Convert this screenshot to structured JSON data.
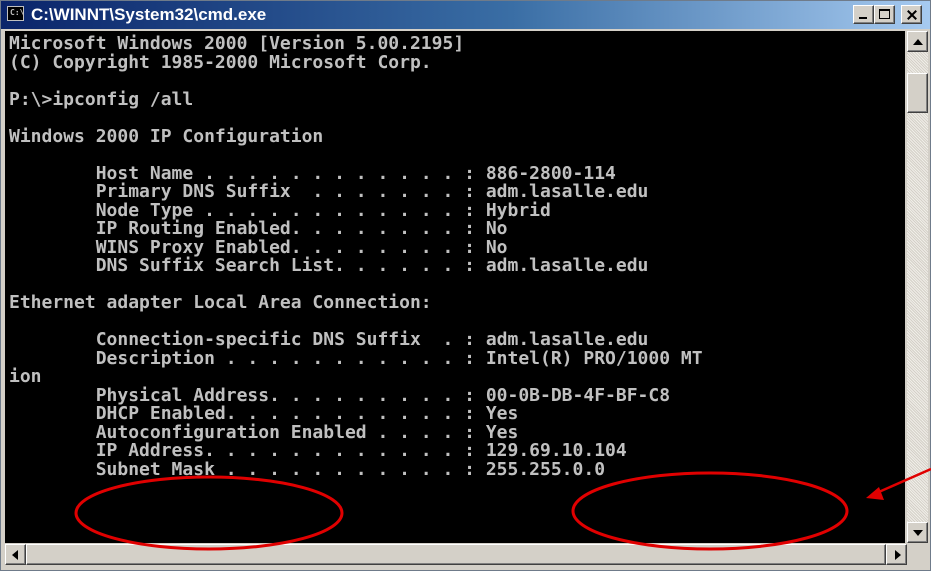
{
  "window": {
    "title": "C:\\WINNT\\System32\\cmd.exe",
    "icon_glyph": "C:\\"
  },
  "console": {
    "lines": [
      "Microsoft Windows 2000 [Version 5.00.2195]",
      "(C) Copyright 1985-2000 Microsoft Corp.",
      "",
      "P:\\>ipconfig /all",
      "",
      "Windows 2000 IP Configuration",
      "",
      "        Host Name . . . . . . . . . . . . : 886-2800-114",
      "        Primary DNS Suffix  . . . . . . . : adm.lasalle.edu",
      "        Node Type . . . . . . . . . . . . : Hybrid",
      "        IP Routing Enabled. . . . . . . . : No",
      "        WINS Proxy Enabled. . . . . . . . : No",
      "        DNS Suffix Search List. . . . . . : adm.lasalle.edu",
      "",
      "Ethernet adapter Local Area Connection:",
      "",
      "        Connection-specific DNS Suffix  . : adm.lasalle.edu",
      "        Description . . . . . . . . . . . : Intel(R) PRO/1000 MT",
      "ion",
      "        Physical Address. . . . . . . . . : 00-0B-DB-4F-BF-C8",
      "        DHCP Enabled. . . . . . . . . . . : Yes",
      "        Autoconfiguration Enabled . . . . : Yes",
      "        IP Address. . . . . . . . . . . . : 129.69.10.104",
      "        Subnet Mask . . . . . . . . . . . : 255.255.0.0"
    ]
  },
  "colors": {
    "console_bg": "#000000",
    "console_fg": "#c0c0c0",
    "annotation": "#e00000",
    "titlebar_start": "#0a246a",
    "titlebar_end": "#a6caf0"
  }
}
